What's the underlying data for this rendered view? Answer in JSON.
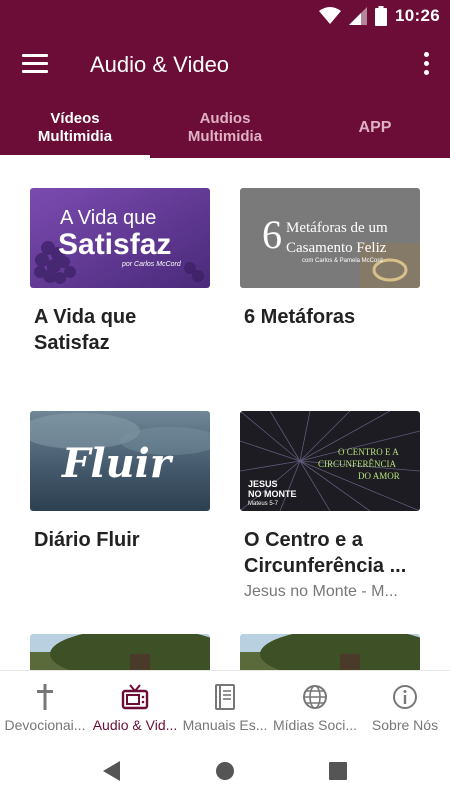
{
  "status_bar": {
    "time": "10:26"
  },
  "app_bar": {
    "title": "Audio & Video"
  },
  "tabs": [
    {
      "line1": "Vídeos",
      "line2": "Multimidia",
      "active": true
    },
    {
      "line1": "Audios",
      "line2": "Multimidia",
      "active": false
    },
    {
      "line1": "APP",
      "line2": "",
      "active": false
    }
  ],
  "cards": [
    {
      "title": "A Vida que Satisfaz",
      "subtitle": "",
      "thumb": {
        "line1": "A Vida que",
        "line2": "Satisfaz",
        "credit": "por Carlos McCord"
      }
    },
    {
      "title": "6 Metáforas",
      "subtitle": "",
      "thumb": {
        "number": "6",
        "line1": "Metáforas de um",
        "line2": "Casamento Feliz",
        "credit": "com Carlos & Pamela McCord"
      }
    },
    {
      "title": "Diário Fluir",
      "subtitle": "",
      "thumb": {
        "word": "Fluir"
      }
    },
    {
      "title": "O Centro e a Circunferência ...",
      "subtitle": "Jesus no Monte - M...",
      "thumb": {
        "l1": "JESUS",
        "l2": "NO MONTE",
        "l3": "Mateus 5-7",
        "r1": "O CENTRO E A",
        "r2": "CIRCUNFERÊNCIA",
        "r3": "DO AMOR"
      }
    },
    {
      "title": "",
      "subtitle": ""
    },
    {
      "title": "",
      "subtitle": ""
    }
  ],
  "bottom_nav": [
    {
      "label": "Devocionai...",
      "icon": "cross-icon",
      "active": false
    },
    {
      "label": "Audio & Vid...",
      "icon": "tv-icon",
      "active": true
    },
    {
      "label": "Manuais Es...",
      "icon": "book-icon",
      "active": false
    },
    {
      "label": "Mídias Soci...",
      "icon": "globe-icon",
      "active": false
    },
    {
      "label": "Sobre Nós",
      "icon": "info-icon",
      "active": false
    }
  ],
  "colors": {
    "primary": "#6b0d36",
    "inactive": "#777777",
    "tab_inactive": "#e0b0c5"
  }
}
